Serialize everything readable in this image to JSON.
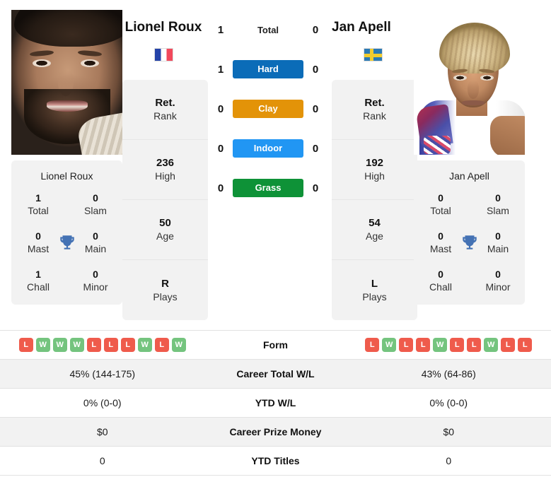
{
  "players": {
    "left": {
      "name": "Lionel Roux",
      "flag": "flag-france",
      "photo_alt": "lionel-roux-photo",
      "info": [
        {
          "value": "Ret.",
          "key": "Rank"
        },
        {
          "value": "236",
          "key": "High"
        },
        {
          "value": "50",
          "key": "Age"
        },
        {
          "value": "R",
          "key": "Plays"
        }
      ],
      "titles": {
        "heading": "Lionel Roux",
        "icon": "trophy-icon",
        "rows": [
          {
            "left_value": "1",
            "left_key": "Total",
            "right_value": "0",
            "right_key": "Slam"
          },
          {
            "left_value": "0",
            "left_key": "Mast",
            "right_value": "0",
            "right_key": "Main"
          },
          {
            "left_value": "1",
            "left_key": "Chall",
            "right_value": "0",
            "right_key": "Minor"
          }
        ]
      }
    },
    "right": {
      "name": "Jan Apell",
      "flag": "flag-sweden",
      "photo_alt": "jan-apell-photo",
      "info": [
        {
          "value": "Ret.",
          "key": "Rank"
        },
        {
          "value": "192",
          "key": "High"
        },
        {
          "value": "54",
          "key": "Age"
        },
        {
          "value": "L",
          "key": "Plays"
        }
      ],
      "titles": {
        "heading": "Jan Apell",
        "icon": "trophy-icon",
        "rows": [
          {
            "left_value": "0",
            "left_key": "Total",
            "right_value": "0",
            "right_key": "Slam"
          },
          {
            "left_value": "0",
            "left_key": "Mast",
            "right_value": "0",
            "right_key": "Main"
          },
          {
            "left_value": "0",
            "left_key": "Chall",
            "right_value": "0",
            "right_key": "Minor"
          }
        ]
      }
    }
  },
  "head_to_head": [
    {
      "label": "Total",
      "left": "1",
      "right": "0",
      "style": "plain",
      "color": ""
    },
    {
      "label": "Hard",
      "left": "1",
      "right": "0",
      "style": "badge",
      "color": "#0B6CB8"
    },
    {
      "label": "Clay",
      "left": "0",
      "right": "0",
      "style": "badge",
      "color": "#E39308"
    },
    {
      "label": "Indoor",
      "left": "0",
      "right": "0",
      "style": "badge",
      "color": "#2196F3"
    },
    {
      "label": "Grass",
      "left": "0",
      "right": "0",
      "style": "badge",
      "color": "#0E9237"
    }
  ],
  "stats_table": {
    "form_label": "Form",
    "left_form": [
      "L",
      "W",
      "W",
      "W",
      "L",
      "L",
      "L",
      "W",
      "L",
      "W"
    ],
    "right_form": [
      "L",
      "W",
      "L",
      "L",
      "W",
      "L",
      "L",
      "W",
      "L",
      "L"
    ],
    "rows": [
      {
        "label": "Career Total W/L",
        "left": "45% (144-175)",
        "right": "43% (64-86)",
        "shaded": true
      },
      {
        "label": "YTD W/L",
        "left": "0% (0-0)",
        "right": "0% (0-0)",
        "shaded": false
      },
      {
        "label": "Career Prize Money",
        "left": "$0",
        "right": "$0",
        "shaded": true
      },
      {
        "label": "YTD Titles",
        "left": "0",
        "right": "0",
        "shaded": false
      }
    ]
  },
  "colors": {
    "card_bg": "#F2F2F2",
    "win": "#74C47E",
    "loss": "#EF5B4C",
    "trophy": "#4472B4"
  }
}
